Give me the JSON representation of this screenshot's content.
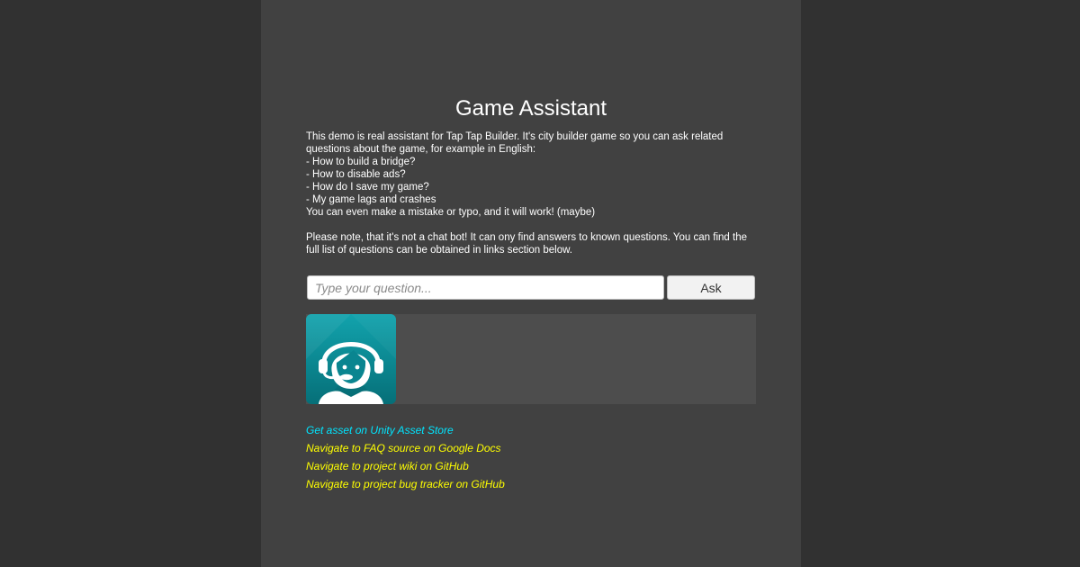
{
  "header": {
    "title": "Game Assistant"
  },
  "description": {
    "text": "This demo is real assistant for Tap Tap Builder. It's city builder game so you can ask related questions about the game, for example in English:\n- How to build a bridge?\n- How to disable ads?\n- How do I save my game?\n- My game lags and crashes\nYou can even make a mistake or typo, and it will work! (maybe)\n\nPlease note, that it's not a chat bot! It can ony find answers to known questions. You can find the full list of questions can be obtained in links section below."
  },
  "question": {
    "value": "",
    "placeholder": "Type your question...",
    "ask_label": "Ask"
  },
  "assistant": {
    "avatar_icon": "headset-agent-icon"
  },
  "links": [
    {
      "label": "Get asset on Unity Asset Store",
      "color": "#00e5ff"
    },
    {
      "label": "Navigate to FAQ source on Google Docs",
      "color": "#ffff00"
    },
    {
      "label": "Navigate to project wiki on GitHub",
      "color": "#ffff00"
    },
    {
      "label": "Navigate to project bug tracker on GitHub",
      "color": "#ffff00"
    }
  ],
  "colors": {
    "background": "#313131",
    "panel": "#414141",
    "chat_area": "#4d4d4d",
    "avatar_teal": "#0a8590"
  }
}
